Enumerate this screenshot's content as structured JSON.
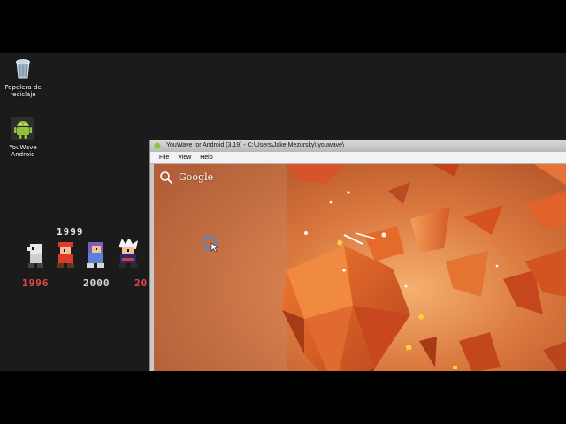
{
  "desktop": {
    "icons": [
      {
        "label_line1": "Papelera de",
        "label_line2": "reciclaje",
        "icon": "recycle-bin-icon"
      },
      {
        "label_line1": "YouWave",
        "label_line2": "Android",
        "icon": "android-icon"
      }
    ],
    "wallpaper_years": {
      "top": "1999",
      "left": "1996",
      "middle": "2000",
      "right": "20"
    }
  },
  "window": {
    "title": "YouWave for Android (3.19) - C:\\Users\\Jake Mezursky\\.youwave\\",
    "menu": [
      "File",
      "View",
      "Help"
    ]
  },
  "android_screen": {
    "search_label": "Google",
    "wallpaper_accent": "#e2622c",
    "bottom_icon": "globe-icon",
    "busy_indicator": "loading-cursor-icon"
  }
}
